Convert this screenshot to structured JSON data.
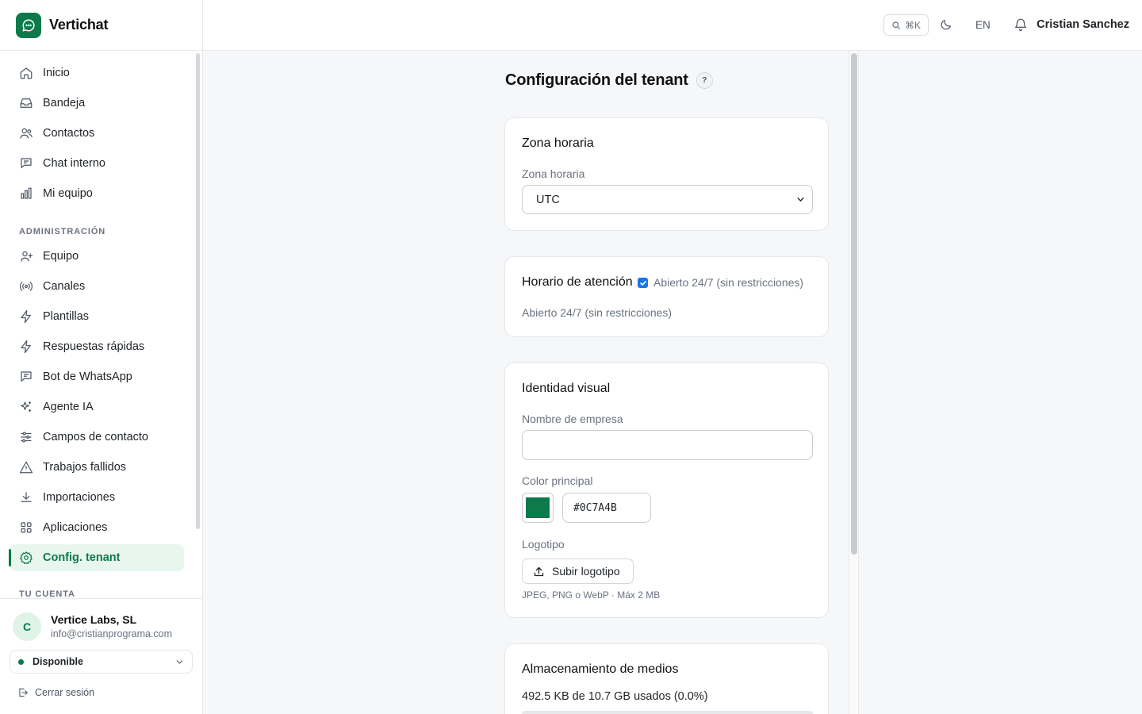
{
  "brand": {
    "name": "Vertichat",
    "color": "#0C7A4B"
  },
  "sidebar": {
    "main_items": [
      {
        "label": "Inicio",
        "icon": "home-icon"
      },
      {
        "label": "Bandeja",
        "icon": "inbox-icon"
      },
      {
        "label": "Contactos",
        "icon": "users-icon"
      },
      {
        "label": "Chat interno",
        "icon": "chat-icon"
      },
      {
        "label": "Mi equipo",
        "icon": "bar-chart-icon"
      }
    ],
    "admin_label": "ADMINISTRACIÓN",
    "admin_items": [
      {
        "label": "Equipo",
        "icon": "user-plus-icon"
      },
      {
        "label": "Canales",
        "icon": "radio-icon"
      },
      {
        "label": "Plantillas",
        "icon": "bolt-icon"
      },
      {
        "label": "Respuestas rápidas",
        "icon": "bolt-icon"
      },
      {
        "label": "Bot de WhatsApp",
        "icon": "chat-icon"
      },
      {
        "label": "Agente IA",
        "icon": "sparkles-icon"
      },
      {
        "label": "Campos de contacto",
        "icon": "sliders-icon"
      },
      {
        "label": "Trabajos fallidos",
        "icon": "warning-icon"
      },
      {
        "label": "Importaciones",
        "icon": "download-icon"
      },
      {
        "label": "Aplicaciones",
        "icon": "grid-icon"
      },
      {
        "label": "Config. tenant",
        "icon": "gear-icon",
        "active": true
      }
    ],
    "account_label": "TU CUENTA",
    "account": {
      "initial": "C",
      "name": "Vertice Labs, SL",
      "email": "info@cristianprograma.com",
      "status": "Disponible",
      "logout": "Cerrar sesión"
    }
  },
  "topbar": {
    "search_shortcut": "⌘K",
    "language": "EN",
    "user_name": "Cristian Sanchez"
  },
  "page": {
    "title": "Configuración del tenant",
    "help": "?"
  },
  "timezone_card": {
    "title": "Zona horaria",
    "field_label": "Zona horaria",
    "value": "UTC"
  },
  "hours_card": {
    "title": "Horario de atención",
    "checkbox_label": "Abierto 24/7 (sin restricciones)",
    "checked": true,
    "summary": "Abierto 24/7 (sin restricciones)"
  },
  "identity_card": {
    "title": "Identidad visual",
    "company_label": "Nombre de empresa",
    "company_value": "",
    "color_label": "Color principal",
    "color_value": "#0C7A4B",
    "logo_label": "Logotipo",
    "upload_label": "Subir logotipo",
    "hint": "JPEG, PNG o WebP · Máx 2 MB"
  },
  "storage_card": {
    "title": "Almacenamiento de medios",
    "usage": "492.5 KB de 10.7 GB usados (0.0%)",
    "percent": 0.0
  }
}
